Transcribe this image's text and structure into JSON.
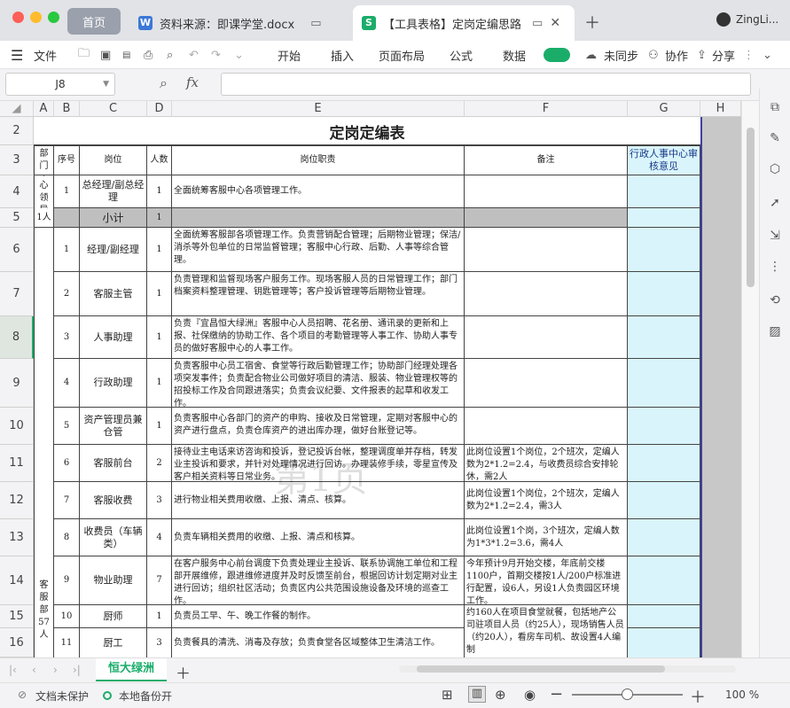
{
  "tabs": {
    "home": "首页",
    "doc": "资料来源：即课学堂.docx",
    "sheet": "【工具表格】定岗定编思路",
    "user": "ZingLi..."
  },
  "menu": {
    "file": "文件",
    "items": [
      "开始",
      "插入",
      "页面布局",
      "公式",
      "数据"
    ],
    "sync": "未同步",
    "collab": "协作",
    "share": "分享"
  },
  "formula": {
    "cell_ref": "J8",
    "fx": "fx"
  },
  "columns": [
    "A",
    "B",
    "C",
    "D",
    "E",
    "F",
    "G",
    "H"
  ],
  "rows": [
    "2",
    "3",
    "4",
    "5",
    "6",
    "7",
    "8",
    "9",
    "10",
    "11",
    "12",
    "13",
    "14",
    "15",
    "16"
  ],
  "table": {
    "title": "定岗定编表",
    "headers": {
      "dept": "部门",
      "no": "序号",
      "post": "岗位",
      "count": "人数",
      "duty": "岗位职责",
      "note": "备注",
      "hr": "行政人事中心审核意见"
    },
    "dept_lead": "中心领导",
    "dept_lead_count": "1人",
    "dept_service": "客服部",
    "dept_service_count": "57人",
    "row4": {
      "no": "1",
      "post": "总经理/副总经理",
      "count": "1",
      "duty": "全面统筹客服中心各项管理工作。"
    },
    "row5": {
      "post": "小计",
      "count": "1"
    },
    "row6": {
      "no": "1",
      "post": "经理/副经理",
      "count": "1",
      "duty": "全面统筹客服部各项管理工作。负责营销配合管理；后期物业管理；保洁/消杀等外包单位的日常监督管理；客服中心行政、后勤、人事等综合管理。"
    },
    "row7": {
      "no": "2",
      "post": "客服主管",
      "count": "1",
      "duty": "负责管理和监督现场客户服务工作。现场客服人员的日常管理工作；部门档案资料整理管理、钥匙管理等；客户投诉管理等后期物业管理。"
    },
    "row8": {
      "no": "3",
      "post": "人事助理",
      "count": "1",
      "duty": "负责『宜昌恒大绿洲』客服中心人员招聘、花名册、通讯录的更新和上报、社保缴纳的协助工作、各个项目的考勤管理等人事工作、协助人事专员的做好客服中心的人事工作。"
    },
    "row9": {
      "no": "4",
      "post": "行政助理",
      "count": "1",
      "duty": "负责客服中心员工宿舍、食堂等行政后勤管理工作；协助部门经理处理各项突发事件；负责配合物业公司做好项目的清洁、服装、物业管理权等的招投标工作及合同跟进落实；负责会议纪要、文件报表的起草和收发工作。"
    },
    "row10": {
      "no": "5",
      "post": "资产管理员兼仓管",
      "count": "1",
      "duty": "负责客服中心各部门的资产的申购、接收及日常管理，定期对客服中心的资产进行盘点，负责仓库资产的进出库办理，做好台账登记等。"
    },
    "row11": {
      "no": "6",
      "post": "客服前台",
      "count": "2",
      "duty": "接待业主电话来访咨询和投诉，登记投诉台帐，整理调度单并存档，转发业主投诉和要求，并针对处理情况进行回访。办理装修手续，零星宣传及客户相关资料等日常业务。",
      "note": "此岗位设置1个岗位，2个班次，定编人数为2*1.2=2.4，与收费员综合安排轮休，需2人"
    },
    "row12": {
      "no": "7",
      "post": "客服收费",
      "count": "3",
      "duty": "进行物业相关费用收缴、上报、清点、核算。",
      "note": "此岗位设置1个岗位，2个班次，定编人数为2*1.2=2.4，需3人"
    },
    "row13": {
      "no": "8",
      "post": "收费员（车辆类）",
      "count": "4",
      "duty": "负责车辆相关费用的收缴、上报、清点和核算。",
      "note": "此岗位设置1个岗，3个班次，定编人数为1*3*1.2=3.6，需4人"
    },
    "row14": {
      "no": "9",
      "post": "物业助理",
      "count": "7",
      "duty": "在客户服务中心前台调度下负责处理业主投诉、联系协调施工单位和工程部开展维修，跟进维修进度并及时反馈至前台，根据回访计划定期对业主进行回访；组织社区活动；负责区内公共范围设施设备及环境的巡查工作。",
      "note": "今年预计9月开始交楼，年底前交楼1100户，首期交楼按1人/200户标准进行配置，设6人，另设1人负责园区环境工作。"
    },
    "row15": {
      "no": "10",
      "post": "厨师",
      "count": "1",
      "duty": "负责员工早、午、晚工作餐的制作。",
      "note": "约160人在项目食堂就餐，包括地产公司驻项目人员（约25人），现场销售人员（约20人），看房车司机、故设置4人编制"
    },
    "row16": {
      "no": "11",
      "post": "厨工",
      "count": "3",
      "duty": "负责餐具的清洗、消毒及存放；负责食堂各区域整体卫生清洁工作。"
    }
  },
  "watermark": "第1页",
  "sheet_tab": "恒大绿洲",
  "status": {
    "protect": "文档未保护",
    "backup": "本地备份开",
    "zoom": "100 %"
  },
  "colors": {
    "accent": "#1aad6a",
    "highlight": "#d9f5fb",
    "subtotal": "#bfbfbf"
  }
}
